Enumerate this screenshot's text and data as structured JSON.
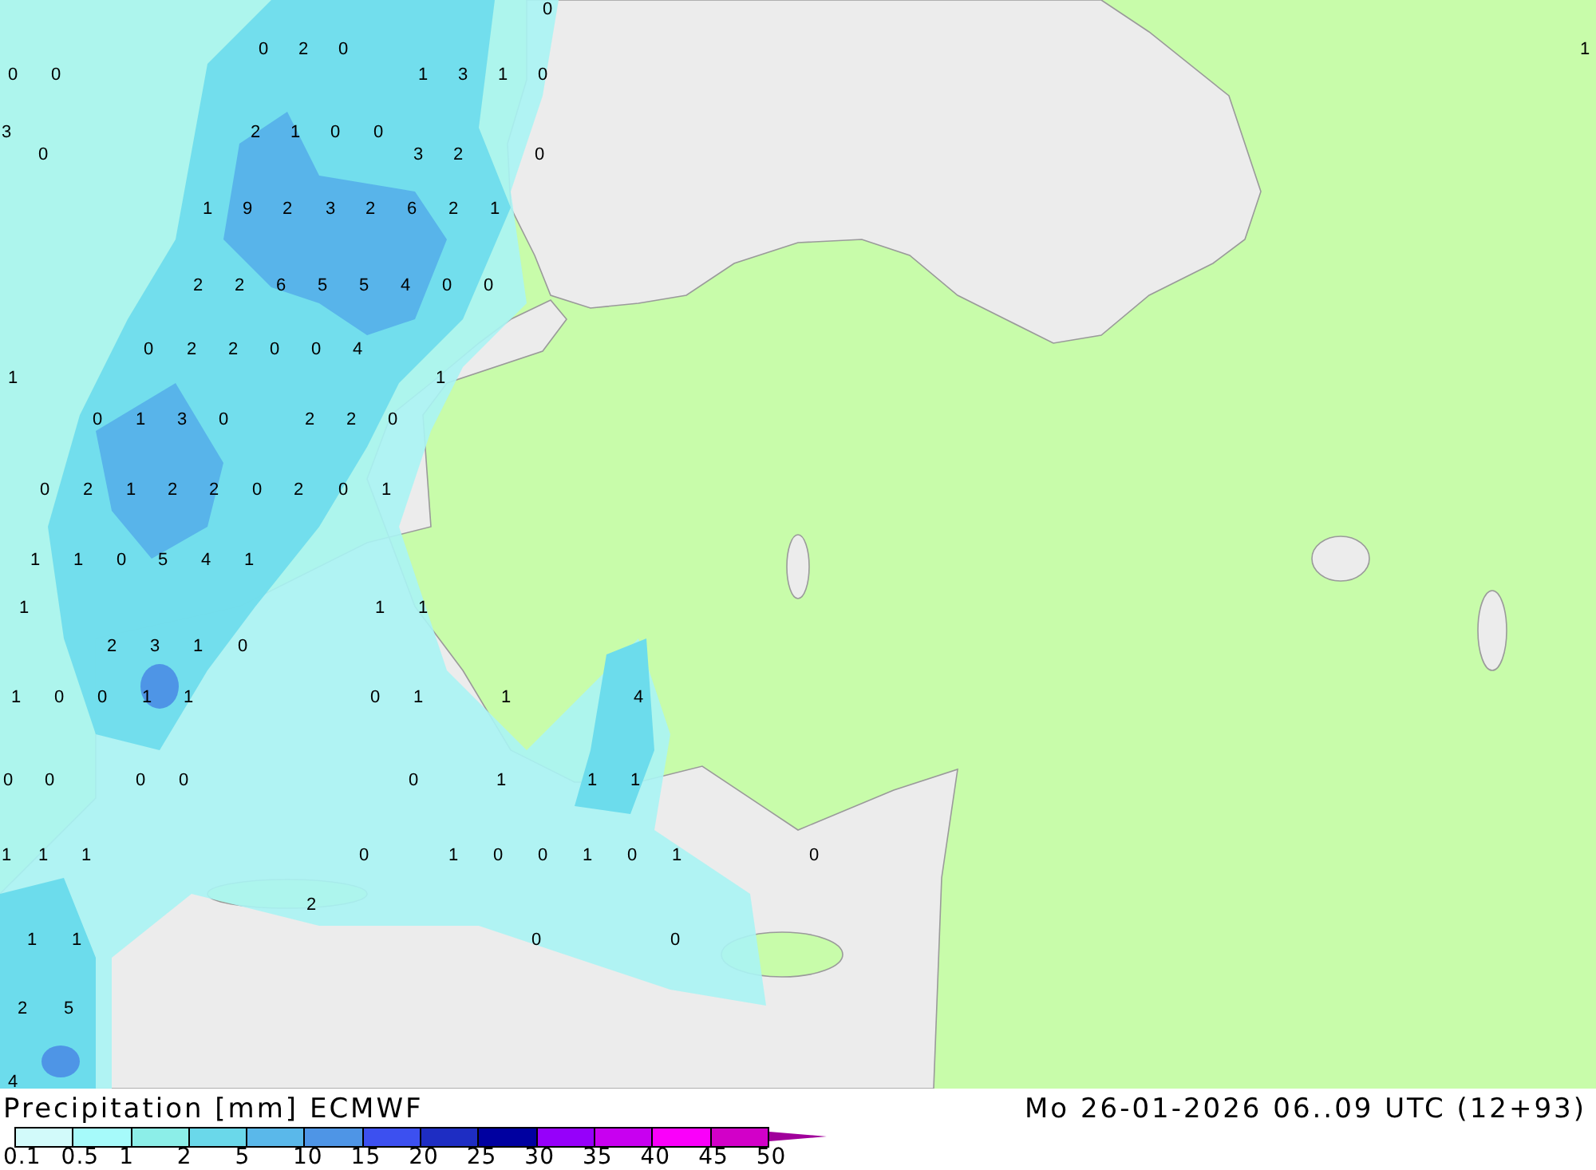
{
  "map": {
    "values": [
      "0",
      "0",
      "2",
      "0",
      "1",
      "0",
      "0",
      "1",
      "3",
      "1",
      "0",
      "3",
      "2",
      "1",
      "0",
      "0",
      "0",
      "3",
      "2",
      "0",
      "1",
      "9",
      "2",
      "3",
      "2",
      "6",
      "2",
      "1",
      "2",
      "2",
      "6",
      "5",
      "5",
      "4",
      "0",
      "0",
      "0",
      "2",
      "2",
      "0",
      "0",
      "4",
      "1",
      "1",
      "0",
      "1",
      "3",
      "0",
      "2",
      "2",
      "0",
      "0",
      "2",
      "1",
      "2",
      "2",
      "0",
      "2",
      "0",
      "1",
      "1",
      "1",
      "0",
      "5",
      "4",
      "1",
      "1",
      "1",
      "1",
      "2",
      "3",
      "1",
      "0",
      "1",
      "0",
      "0",
      "1",
      "1",
      "0",
      "1",
      "1",
      "4",
      "0",
      "0",
      "0",
      "0",
      "0",
      "1",
      "1",
      "1",
      "1",
      "1",
      "1",
      "0",
      "1",
      "0",
      "0",
      "1",
      "0",
      "1",
      "0",
      "2",
      "1",
      "1",
      "0",
      "0",
      "2",
      "5",
      "4"
    ]
  },
  "legend": {
    "title": "Precipitation [mm] ECMWF",
    "bins": [
      {
        "color": "#d2fafa",
        "label": "0.1"
      },
      {
        "color": "#a6fafa",
        "label": "0.5"
      },
      {
        "color": "#8ceee8",
        "label": "1"
      },
      {
        "color": "#6ad8ea",
        "label": "2"
      },
      {
        "color": "#5ab8ea",
        "label": "5"
      },
      {
        "color": "#4e95e6",
        "label": "10"
      },
      {
        "color": "#3c50f0",
        "label": "15"
      },
      {
        "color": "#1e2dc3",
        "label": "20"
      },
      {
        "color": "#0000a0",
        "label": "25"
      },
      {
        "color": "#9600fa",
        "label": "30"
      },
      {
        "color": "#c800f0",
        "label": "35"
      },
      {
        "color": "#fa00fa",
        "label": "40"
      },
      {
        "color": "#d200c8",
        "label": "45"
      }
    ],
    "end_label": "50",
    "overflow": {
      "color": "#a0009b"
    }
  },
  "valid_time": "Mo 26-01-2026 06..09 UTC (12+93)"
}
